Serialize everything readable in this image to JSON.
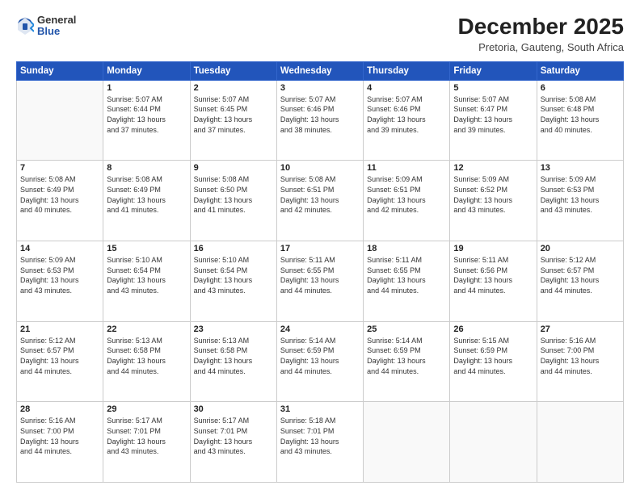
{
  "logo": {
    "general": "General",
    "blue": "Blue"
  },
  "header": {
    "title": "December 2025",
    "location": "Pretoria, Gauteng, South Africa"
  },
  "weekdays": [
    "Sunday",
    "Monday",
    "Tuesday",
    "Wednesday",
    "Thursday",
    "Friday",
    "Saturday"
  ],
  "weeks": [
    [
      {
        "day": "",
        "sunrise": "",
        "sunset": "",
        "daylight": ""
      },
      {
        "day": "1",
        "sunrise": "Sunrise: 5:07 AM",
        "sunset": "Sunset: 6:44 PM",
        "daylight": "Daylight: 13 hours and 37 minutes."
      },
      {
        "day": "2",
        "sunrise": "Sunrise: 5:07 AM",
        "sunset": "Sunset: 6:45 PM",
        "daylight": "Daylight: 13 hours and 37 minutes."
      },
      {
        "day": "3",
        "sunrise": "Sunrise: 5:07 AM",
        "sunset": "Sunset: 6:46 PM",
        "daylight": "Daylight: 13 hours and 38 minutes."
      },
      {
        "day": "4",
        "sunrise": "Sunrise: 5:07 AM",
        "sunset": "Sunset: 6:46 PM",
        "daylight": "Daylight: 13 hours and 39 minutes."
      },
      {
        "day": "5",
        "sunrise": "Sunrise: 5:07 AM",
        "sunset": "Sunset: 6:47 PM",
        "daylight": "Daylight: 13 hours and 39 minutes."
      },
      {
        "day": "6",
        "sunrise": "Sunrise: 5:08 AM",
        "sunset": "Sunset: 6:48 PM",
        "daylight": "Daylight: 13 hours and 40 minutes."
      }
    ],
    [
      {
        "day": "7",
        "sunrise": "Sunrise: 5:08 AM",
        "sunset": "Sunset: 6:49 PM",
        "daylight": "Daylight: 13 hours and 40 minutes."
      },
      {
        "day": "8",
        "sunrise": "Sunrise: 5:08 AM",
        "sunset": "Sunset: 6:49 PM",
        "daylight": "Daylight: 13 hours and 41 minutes."
      },
      {
        "day": "9",
        "sunrise": "Sunrise: 5:08 AM",
        "sunset": "Sunset: 6:50 PM",
        "daylight": "Daylight: 13 hours and 41 minutes."
      },
      {
        "day": "10",
        "sunrise": "Sunrise: 5:08 AM",
        "sunset": "Sunset: 6:51 PM",
        "daylight": "Daylight: 13 hours and 42 minutes."
      },
      {
        "day": "11",
        "sunrise": "Sunrise: 5:09 AM",
        "sunset": "Sunset: 6:51 PM",
        "daylight": "Daylight: 13 hours and 42 minutes."
      },
      {
        "day": "12",
        "sunrise": "Sunrise: 5:09 AM",
        "sunset": "Sunset: 6:52 PM",
        "daylight": "Daylight: 13 hours and 43 minutes."
      },
      {
        "day": "13",
        "sunrise": "Sunrise: 5:09 AM",
        "sunset": "Sunset: 6:53 PM",
        "daylight": "Daylight: 13 hours and 43 minutes."
      }
    ],
    [
      {
        "day": "14",
        "sunrise": "Sunrise: 5:09 AM",
        "sunset": "Sunset: 6:53 PM",
        "daylight": "Daylight: 13 hours and 43 minutes."
      },
      {
        "day": "15",
        "sunrise": "Sunrise: 5:10 AM",
        "sunset": "Sunset: 6:54 PM",
        "daylight": "Daylight: 13 hours and 43 minutes."
      },
      {
        "day": "16",
        "sunrise": "Sunrise: 5:10 AM",
        "sunset": "Sunset: 6:54 PM",
        "daylight": "Daylight: 13 hours and 43 minutes."
      },
      {
        "day": "17",
        "sunrise": "Sunrise: 5:11 AM",
        "sunset": "Sunset: 6:55 PM",
        "daylight": "Daylight: 13 hours and 44 minutes."
      },
      {
        "day": "18",
        "sunrise": "Sunrise: 5:11 AM",
        "sunset": "Sunset: 6:55 PM",
        "daylight": "Daylight: 13 hours and 44 minutes."
      },
      {
        "day": "19",
        "sunrise": "Sunrise: 5:11 AM",
        "sunset": "Sunset: 6:56 PM",
        "daylight": "Daylight: 13 hours and 44 minutes."
      },
      {
        "day": "20",
        "sunrise": "Sunrise: 5:12 AM",
        "sunset": "Sunset: 6:57 PM",
        "daylight": "Daylight: 13 hours and 44 minutes."
      }
    ],
    [
      {
        "day": "21",
        "sunrise": "Sunrise: 5:12 AM",
        "sunset": "Sunset: 6:57 PM",
        "daylight": "Daylight: 13 hours and 44 minutes."
      },
      {
        "day": "22",
        "sunrise": "Sunrise: 5:13 AM",
        "sunset": "Sunset: 6:58 PM",
        "daylight": "Daylight: 13 hours and 44 minutes."
      },
      {
        "day": "23",
        "sunrise": "Sunrise: 5:13 AM",
        "sunset": "Sunset: 6:58 PM",
        "daylight": "Daylight: 13 hours and 44 minutes."
      },
      {
        "day": "24",
        "sunrise": "Sunrise: 5:14 AM",
        "sunset": "Sunset: 6:59 PM",
        "daylight": "Daylight: 13 hours and 44 minutes."
      },
      {
        "day": "25",
        "sunrise": "Sunrise: 5:14 AM",
        "sunset": "Sunset: 6:59 PM",
        "daylight": "Daylight: 13 hours and 44 minutes."
      },
      {
        "day": "26",
        "sunrise": "Sunrise: 5:15 AM",
        "sunset": "Sunset: 6:59 PM",
        "daylight": "Daylight: 13 hours and 44 minutes."
      },
      {
        "day": "27",
        "sunrise": "Sunrise: 5:16 AM",
        "sunset": "Sunset: 7:00 PM",
        "daylight": "Daylight: 13 hours and 44 minutes."
      }
    ],
    [
      {
        "day": "28",
        "sunrise": "Sunrise: 5:16 AM",
        "sunset": "Sunset: 7:00 PM",
        "daylight": "Daylight: 13 hours and 44 minutes."
      },
      {
        "day": "29",
        "sunrise": "Sunrise: 5:17 AM",
        "sunset": "Sunset: 7:01 PM",
        "daylight": "Daylight: 13 hours and 43 minutes."
      },
      {
        "day": "30",
        "sunrise": "Sunrise: 5:17 AM",
        "sunset": "Sunset: 7:01 PM",
        "daylight": "Daylight: 13 hours and 43 minutes."
      },
      {
        "day": "31",
        "sunrise": "Sunrise: 5:18 AM",
        "sunset": "Sunset: 7:01 PM",
        "daylight": "Daylight: 13 hours and 43 minutes."
      },
      {
        "day": "",
        "sunrise": "",
        "sunset": "",
        "daylight": ""
      },
      {
        "day": "",
        "sunrise": "",
        "sunset": "",
        "daylight": ""
      },
      {
        "day": "",
        "sunrise": "",
        "sunset": "",
        "daylight": ""
      }
    ]
  ]
}
